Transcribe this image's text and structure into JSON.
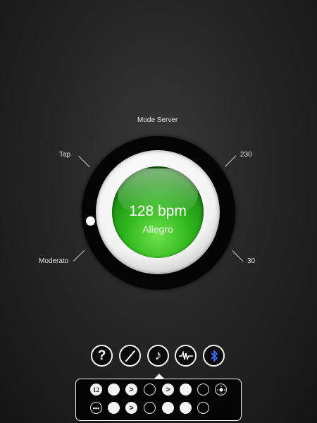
{
  "dial": {
    "mode_label": "Mode Server",
    "tap_label": "Tap",
    "max_label": "230",
    "min_label": "30",
    "moderato_label": "Moderato",
    "bpm_text": "128 bpm",
    "tempo_name": "Allegro"
  },
  "toolbar": {
    "help_glyph": "?",
    "music_glyph": "♪"
  },
  "beat_panel": {
    "row1": [
      {
        "kind": "time-signature",
        "icon": "time-signature-12-icon"
      },
      {
        "kind": "full"
      },
      {
        "kind": "accent",
        "glyph": ">"
      },
      {
        "kind": "empty"
      },
      {
        "kind": "accent",
        "glyph": ">"
      },
      {
        "kind": "full"
      },
      {
        "kind": "empty"
      },
      {
        "kind": "settings",
        "icon": "sun-icon"
      }
    ],
    "row2": [
      {
        "kind": "subdivision",
        "icon": "dots-icon"
      },
      {
        "kind": "full"
      },
      {
        "kind": "accent",
        "glyph": ">"
      },
      {
        "kind": "empty"
      },
      {
        "kind": "full"
      },
      {
        "kind": "full"
      },
      {
        "kind": "empty"
      }
    ]
  },
  "colors": {
    "tempo_green": "#2fb51d",
    "bluetooth_blue": "#3b6cff"
  }
}
